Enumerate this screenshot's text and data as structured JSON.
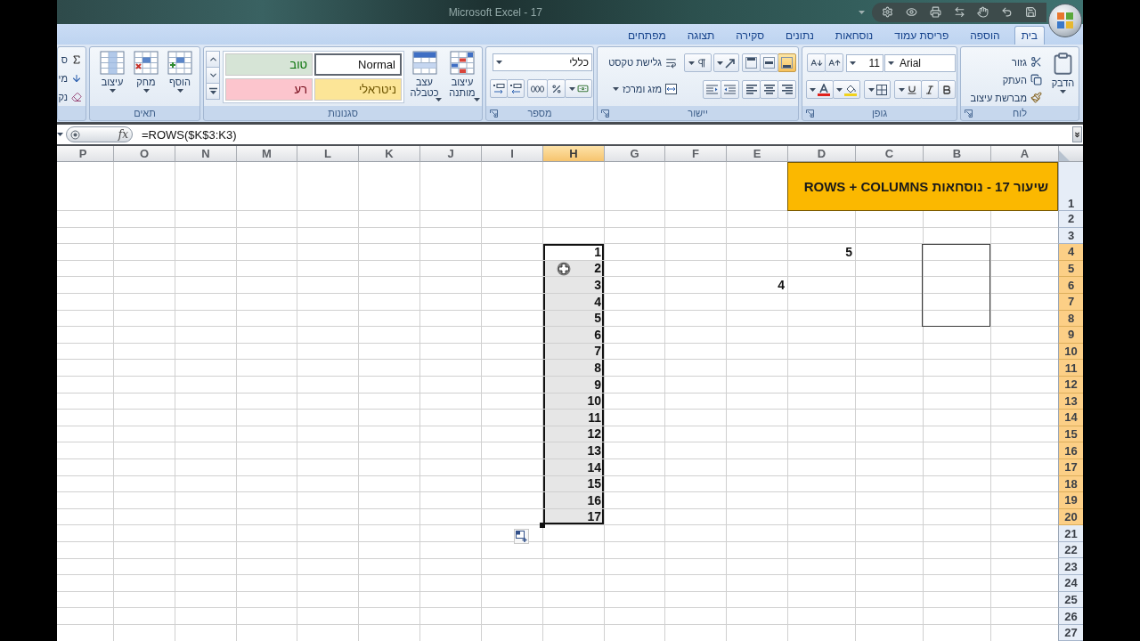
{
  "title_bar": {
    "title": "Microsoft Excel - 17"
  },
  "ribbon": {
    "tabs": [
      {
        "label": "בית",
        "selected": true
      },
      {
        "label": "הוספה",
        "selected": false
      },
      {
        "label": "פריסת עמוד",
        "selected": false
      },
      {
        "label": "נוסחאות",
        "selected": false
      },
      {
        "label": "נתונים",
        "selected": false
      },
      {
        "label": "סקירה",
        "selected": false
      },
      {
        "label": "תצוגה",
        "selected": false
      },
      {
        "label": "מפתחים",
        "selected": false
      }
    ],
    "clipboard": {
      "label": "לוח",
      "paste": "הדבק",
      "cut": "גזור",
      "copy": "העתק",
      "format_painter": "מברשת עיצוב"
    },
    "font": {
      "label": "גופן",
      "font_name": "Arial",
      "font_size": "11"
    },
    "alignment": {
      "label": "יישור",
      "vertical_align": [
        {
          "kind": "bottom",
          "selected": true
        },
        {
          "kind": "middle",
          "selected": false
        },
        {
          "kind": "top",
          "selected": false
        }
      ],
      "wrap_text": "גלישת טקסט",
      "merge": "מזג ומרכז"
    },
    "number": {
      "label": "מספר",
      "format": "כללי"
    },
    "styles": {
      "label": "סגנונות",
      "conditional_formatting": "עיצוב מותנה",
      "format_as_table": "עצב כטבלה",
      "cell_styles": [
        {
          "label": "Normal",
          "color": "#ffffff",
          "selected": true
        },
        {
          "label": "טוב",
          "color": "#d6e4d6",
          "selected": false
        },
        {
          "label": "ניטראלי",
          "color": "#fce597",
          "selected": false
        },
        {
          "label": "רע",
          "color": "#fcc5cd",
          "selected": false
        }
      ]
    },
    "cells": {
      "label": "תאים",
      "buttons": [
        {
          "kind": "insert",
          "label": "הוסף"
        },
        {
          "kind": "delete",
          "label": "מחק"
        },
        {
          "kind": "format",
          "label": "עיצוב"
        }
      ]
    },
    "editing": {
      "buttons": [
        {
          "kind": "sum",
          "label": "ס"
        },
        {
          "kind": "fill",
          "label": "מי"
        },
        {
          "kind": "clear",
          "label": "נק"
        }
      ]
    }
  },
  "formula_bar": {
    "function_button": "fx",
    "formula": "=ROWS($K$3:K3)"
  },
  "sheet": {
    "columns": [
      {
        "label": "A",
        "selected": false
      },
      {
        "label": "B",
        "selected": false
      },
      {
        "label": "C",
        "selected": false
      },
      {
        "label": "D",
        "selected": false
      },
      {
        "label": "E",
        "selected": false
      },
      {
        "label": "F",
        "selected": false
      },
      {
        "label": "G",
        "selected": false
      },
      {
        "label": "H",
        "selected": true
      },
      {
        "label": "I",
        "selected": false
      },
      {
        "label": "J",
        "selected": false
      },
      {
        "label": "K",
        "selected": false
      },
      {
        "label": "L",
        "selected": false
      },
      {
        "label": "M",
        "selected": false
      },
      {
        "label": "N",
        "selected": false
      },
      {
        "label": "O",
        "selected": false
      },
      {
        "label": "P",
        "selected": false
      }
    ],
    "rows": [
      {
        "label": "1",
        "selected": false
      },
      {
        "label": "2",
        "selected": false
      },
      {
        "label": "3",
        "selected": false
      },
      {
        "label": "4",
        "selected": true
      },
      {
        "label": "5",
        "selected": true
      },
      {
        "label": "6",
        "selected": true
      },
      {
        "label": "7",
        "selected": true
      },
      {
        "label": "8",
        "selected": true
      },
      {
        "label": "9",
        "selected": true
      },
      {
        "label": "10",
        "selected": true
      },
      {
        "label": "11",
        "selected": true
      },
      {
        "label": "12",
        "selected": true
      },
      {
        "label": "13",
        "selected": true
      },
      {
        "label": "14",
        "selected": true
      },
      {
        "label": "15",
        "selected": true
      },
      {
        "label": "16",
        "selected": true
      },
      {
        "label": "17",
        "selected": true
      },
      {
        "label": "18",
        "selected": true
      },
      {
        "label": "19",
        "selected": true
      },
      {
        "label": "20",
        "selected": true
      },
      {
        "label": "21",
        "selected": false
      },
      {
        "label": "22",
        "selected": false
      },
      {
        "label": "23",
        "selected": false
      },
      {
        "label": "24",
        "selected": false
      },
      {
        "label": "25",
        "selected": false
      },
      {
        "label": "26",
        "selected": false
      },
      {
        "label": "27",
        "selected": false
      }
    ],
    "title_cell": "שיעור 17 - נוסחאות ROWS + COLUMNS",
    "cell_d4": "5",
    "cell_e6": "4",
    "fill_series": [
      {
        "value": "1",
        "active": true
      },
      {
        "value": "2",
        "active": false
      },
      {
        "value": "3",
        "active": false
      },
      {
        "value": "4",
        "active": false
      },
      {
        "value": "5",
        "active": false
      },
      {
        "value": "6",
        "active": false
      },
      {
        "value": "7",
        "active": false
      },
      {
        "value": "8",
        "active": false
      },
      {
        "value": "9",
        "active": false
      },
      {
        "value": "10",
        "active": false
      },
      {
        "value": "11",
        "active": false
      },
      {
        "value": "12",
        "active": false
      },
      {
        "value": "13",
        "active": false
      },
      {
        "value": "14",
        "active": false
      },
      {
        "value": "15",
        "active": false
      },
      {
        "value": "16",
        "active": false
      },
      {
        "value": "17",
        "active": false
      }
    ]
  }
}
